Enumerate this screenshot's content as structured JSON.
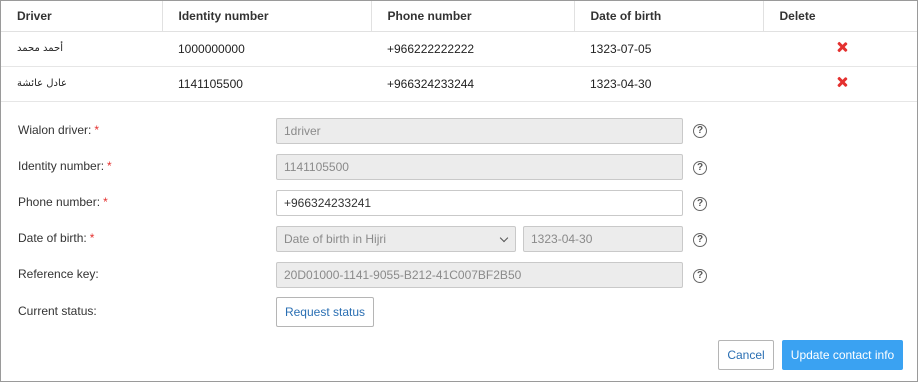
{
  "table": {
    "headers": [
      "Driver",
      "Identity number",
      "Phone number",
      "Date of birth",
      "Delete"
    ],
    "rows": [
      {
        "driver": "أحمد محمد",
        "identity": "1000000000",
        "phone": "+966222222222",
        "dob": "1323-07-05"
      },
      {
        "driver": "عادل عائشة",
        "identity": "1141105500",
        "phone": "+966324233244",
        "dob": "1323-04-30"
      }
    ],
    "delete_icon": "close-icon",
    "delete_color": "#e4312f"
  },
  "form": {
    "wialon_driver": {
      "label": "Wialon driver:",
      "required_mark": "*",
      "value": "1driver"
    },
    "identity_number": {
      "label": "Identity number:",
      "required_mark": "*",
      "value": "1141105500"
    },
    "phone_number": {
      "label": "Phone number:",
      "required_mark": "*",
      "value": "+966324233241"
    },
    "date_of_birth": {
      "label": "Date of birth:",
      "required_mark": "*",
      "calendar_selected": "Date of birth in Hijri",
      "value": "1323-04-30"
    },
    "reference_key": {
      "label": "Reference key:",
      "value": "20D01000-1141-9055-B212-41C007BF2B50"
    },
    "current_status": {
      "label": "Current status:",
      "button": "Request status"
    },
    "help_glyph": "?"
  },
  "actions": {
    "cancel": "Cancel",
    "update": "Update contact info"
  },
  "colors": {
    "primary": "#3aa2f2",
    "link": "#2a6fb3",
    "required": "#e4312f"
  }
}
